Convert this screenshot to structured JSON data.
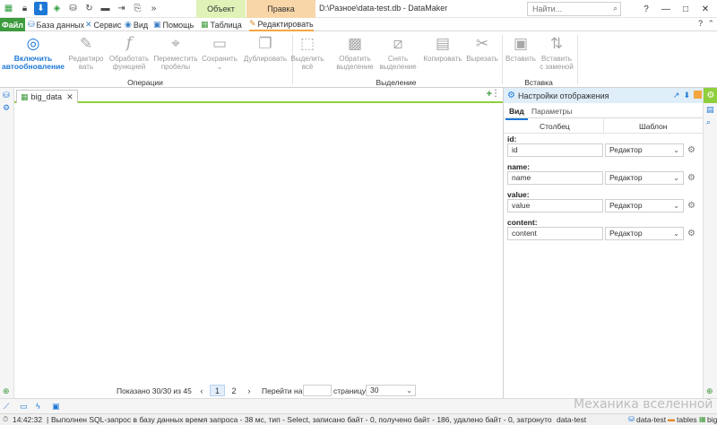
{
  "window": {
    "title": "D:\\Разное\\data-test.db - DataMaker",
    "search_placeholder": "Найти...",
    "controls": [
      "?",
      "—",
      "□",
      "✕"
    ]
  },
  "quick_access": [
    "table",
    "lock",
    "pin",
    "save",
    "db",
    "refresh",
    "folder",
    "login",
    "export",
    "more"
  ],
  "context_groups": {
    "object": "Объект",
    "edit": "Правка"
  },
  "tabs": {
    "file": "Файл",
    "items": [
      {
        "label": "База данных",
        "icon": "database-icon"
      },
      {
        "label": "Сервис",
        "icon": "wrench-icon"
      },
      {
        "label": "Вид",
        "icon": "eye-icon"
      },
      {
        "label": "Помощь",
        "icon": "help-icon"
      },
      {
        "label": "Таблица",
        "icon": "table-icon"
      },
      {
        "label": "Редактировать",
        "icon": "pencil-icon"
      }
    ],
    "help": "?"
  },
  "ribbon": {
    "operations": {
      "label": "Операции",
      "buttons": [
        {
          "label": "Включить автообновление",
          "icon": "auto-refresh-icon"
        },
        {
          "label": "Редактиро вать",
          "icon": "pencil-icon"
        },
        {
          "label": "Обработать функцией",
          "icon": "function-icon"
        },
        {
          "label": "Переместить пробелы",
          "icon": "mouse-icon"
        },
        {
          "label": "Сохранить",
          "icon": "save-icon"
        },
        {
          "label": "Дублировать",
          "icon": "duplicate-icon"
        }
      ]
    },
    "selection": {
      "label": "Выделение",
      "buttons": [
        {
          "label": "Выделить всё",
          "icon": "select-all-icon"
        },
        {
          "label": "Обратить выделение",
          "icon": "invert-selection-icon"
        },
        {
          "label": "Снять выделение",
          "icon": "deselect-icon"
        },
        {
          "label": "Копировать",
          "icon": "copy-icon"
        },
        {
          "label": "Вырезать",
          "icon": "scissors-icon"
        }
      ]
    },
    "insert": {
      "label": "Вставка",
      "buttons": [
        {
          "label": "Вставить",
          "icon": "paste-icon"
        },
        {
          "label": "Вставить с заменой",
          "icon": "paste-replace-icon"
        }
      ]
    }
  },
  "document": {
    "tab_label": "big_data",
    "pager": {
      "shown": "Показано 30/30 из 45",
      "current_page": "1",
      "next_page": "2",
      "goto_label": "Перейти на",
      "goto_value": "",
      "page_word": "страницу",
      "page_size": "30"
    }
  },
  "panel": {
    "title": "Настройки отображения",
    "tabs": [
      "Вид",
      "Параметры"
    ],
    "columns": {
      "column": "Столбец",
      "template": "Шаблон"
    },
    "fields": [
      {
        "label": "id:",
        "value": "id",
        "template": "Редактор"
      },
      {
        "label": "name:",
        "value": "name",
        "template": "Редактор"
      },
      {
        "label": "value:",
        "value": "value",
        "template": "Редактор"
      },
      {
        "label": "content:",
        "value": "content",
        "template": "Редактор"
      }
    ]
  },
  "watermark": "Механика вселенной",
  "status": {
    "time": "14:42:32",
    "message": "Выполнен SQL-запрос в базу данных время запроса - 38 мс, тип - Select, записано байт - 0, получено байт - 186, удалено байт - 0, затронуто строк - 30",
    "db": "data-test",
    "crumbs": [
      "data-test",
      "tables",
      "big"
    ]
  },
  "colors": {
    "accent_green": "#3c9b3c",
    "accent_blue": "#1d78d6",
    "object_group": "#e0f2b8",
    "edit_group": "#f8d6a8"
  }
}
